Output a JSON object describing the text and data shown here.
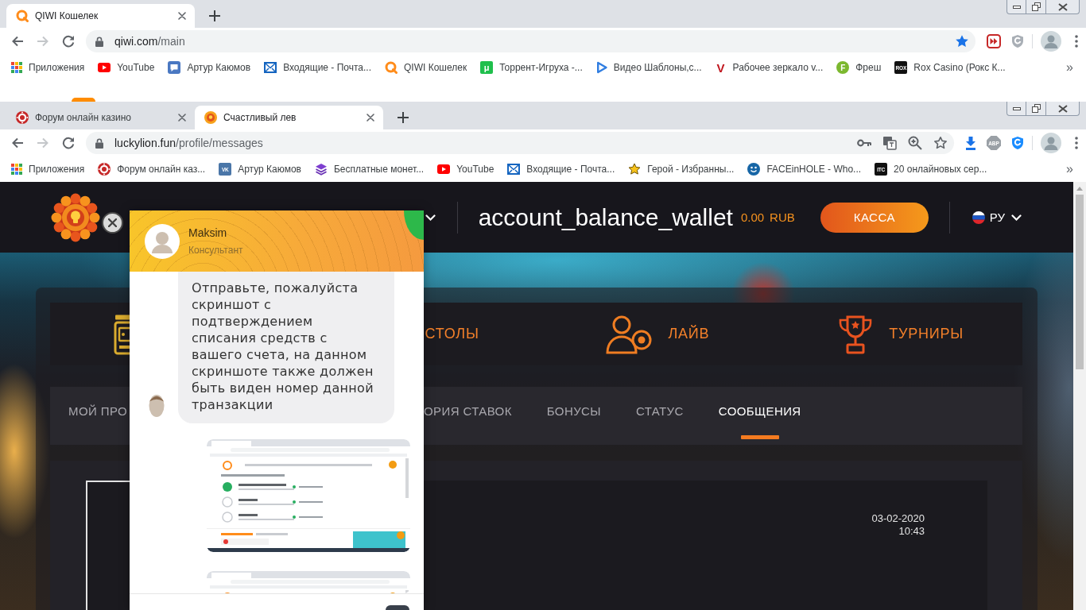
{
  "browser_windows": [
    {
      "tabs": [
        {
          "kind": "ring",
          "title": "QIWI Кошелек",
          "selected": true
        }
      ],
      "address": {
        "host": "qiwi.com",
        "path": "/main"
      },
      "forward_enabled": false,
      "bookmarked": true,
      "extensions": [
        {
          "kind": "fastforward"
        },
        {
          "kind": "shield",
          "color": "#a9afb6"
        }
      ],
      "bookmarks": [
        {
          "kind": "apps",
          "label": "Приложения"
        },
        {
          "kind": "video",
          "label": "YouTube"
        },
        {
          "kind": "chat",
          "label": "Артур Каюмов"
        },
        {
          "kind": "mail",
          "label": "Входящие - Почта..."
        },
        {
          "kind": "ring",
          "label": "QIWI Кошелек"
        },
        {
          "kind": "tile",
          "glyph": "μ",
          "color": "#1fbf4c",
          "label": "Торрент-Игруха -..."
        },
        {
          "kind": "play",
          "label": "Видео Шаблоны,с..."
        },
        {
          "kind": "letter",
          "glyph": "V",
          "color": "#c0161e",
          "label": "Рабочее зеркало v..."
        },
        {
          "kind": "disc",
          "glyph": "F",
          "color": "#7cb82f",
          "label": "Фреш"
        },
        {
          "kind": "tile",
          "glyph": "ROX",
          "color": "#111111",
          "label": "Rox Casino (Рокс К..."
        }
      ],
      "more": "»"
    },
    {
      "tabs": [
        {
          "kind": "roulette",
          "title": "Форум онлайн казино",
          "selected": false
        },
        {
          "kind": "sun",
          "title": "Счастливый лев",
          "selected": true
        }
      ],
      "address": {
        "host": "luckylion.fun",
        "path": "/profile/messages"
      },
      "forward_enabled": false,
      "bookmarked": false,
      "page_actions": [
        {
          "kind": "key"
        },
        {
          "kind": "translate"
        },
        {
          "kind": "zoom"
        }
      ],
      "extensions": [
        {
          "kind": "download"
        },
        {
          "kind": "octagon",
          "glyph": "ABP",
          "color": "#9aa0a6"
        },
        {
          "kind": "shield",
          "color": "#1a8cff"
        }
      ],
      "bookmarks": [
        {
          "kind": "apps",
          "label": "Приложения"
        },
        {
          "kind": "roulette",
          "label": "Форум онлайн каз..."
        },
        {
          "kind": "tile",
          "glyph": "VK",
          "color": "#4a76a8",
          "label": "Артур Каюмов"
        },
        {
          "kind": "layers",
          "label": "Бесплатные монет..."
        },
        {
          "kind": "video",
          "label": "YouTube"
        },
        {
          "kind": "mail",
          "label": "Входящие - Почта..."
        },
        {
          "kind": "star",
          "label": "Герой - Избранны..."
        },
        {
          "kind": "smiley",
          "label": "FACEinHOLE - Who..."
        },
        {
          "kind": "tile",
          "glyph": "ITC",
          "color": "#111111",
          "label": "20 онлайновых сер..."
        }
      ],
      "more": "»"
    }
  ],
  "site": {
    "header": {
      "wallet_label": "account_balance_wallet",
      "balance": "0.00",
      "currency": "RUB",
      "cashier_button": "КАССА",
      "language": "РУ"
    },
    "categories": [
      {
        "kind": "slots"
      },
      {
        "label": "СТОЛЫ"
      },
      {
        "kind": "live",
        "label": "ЛАЙВ"
      },
      {
        "kind": "tournaments",
        "label": "ТУРНИРЫ"
      }
    ],
    "profile_tabs": [
      {
        "label": "МОЙ ПРО",
        "selected": false
      },
      {
        "label": "ОРИЯ СТАВОК",
        "selected": false
      },
      {
        "label": "БОНУСЫ",
        "selected": false
      },
      {
        "label": "СТАТУС",
        "selected": false
      },
      {
        "label": "СООБЩЕНИЯ",
        "selected": true
      }
    ],
    "messages": [
      {
        "date": "03-02-2020",
        "time": "10:43",
        "selected": true
      }
    ]
  },
  "chat": {
    "agent": {
      "name": "Maksim",
      "role": "Консультант",
      "online": true
    },
    "messages": [
      {
        "kind": "text",
        "outgoing": false,
        "text": "Отправьте, пожалуйста скриншот с подтверждением списания средств с вашего счета, на данном скриншоте также должен быть виден номер данной транзакции"
      },
      {
        "kind": "image",
        "outgoing": true
      },
      {
        "kind": "image",
        "outgoing": true
      }
    ]
  }
}
